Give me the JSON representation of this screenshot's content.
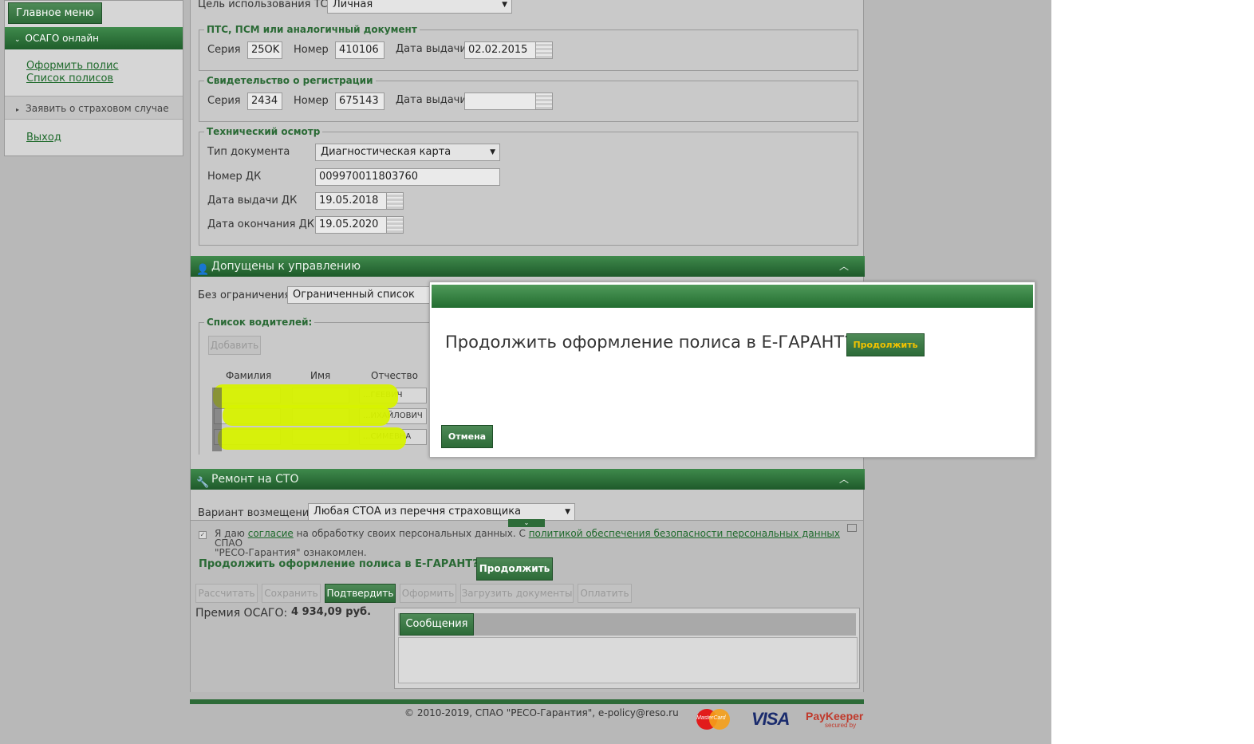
{
  "sidebar": {
    "main_menu": "Главное меню",
    "section_osago": "ОСАГО онлайн",
    "link_issue": "Оформить полис",
    "link_list": "Список полисов",
    "claim": "Заявить о страховом случае",
    "logout": "Выход"
  },
  "vehicle": {
    "purpose_label": "Цель использования ТС",
    "purpose_value": "Личная"
  },
  "pts": {
    "legend": "ПТС, ПСМ или аналогичный документ",
    "series_label": "Серия",
    "series_value": "25OK",
    "number_label": "Номер",
    "number_value": "410106",
    "date_label": "Дата выдачи",
    "date_value": "02.02.2015"
  },
  "registration": {
    "legend": "Свидетельство о регистрации",
    "series_label": "Серия",
    "series_value": "2434",
    "number_label": "Номер",
    "number_value": "675143",
    "date_label": "Дата выдачи",
    "date_value": ""
  },
  "inspection": {
    "legend": "Технический осмотр",
    "doc_type_label": "Тип документа",
    "doc_type_value": "Диагностическая карта",
    "dk_number_label": "Номер ДК",
    "dk_number_value": "009970011803760",
    "dk_issue_label": "Дата выдачи ДК",
    "dk_issue_value": "19.05.2018",
    "dk_end_label": "Дата окончания ДК",
    "dk_end_value": "19.05.2020"
  },
  "drivers_panel": {
    "title": "Допущены к управлению",
    "limit_label": "Без ограничения",
    "limit_value": "Ограниченный список",
    "list_legend": "Список водителей:",
    "add_button": "Добавить",
    "col_last": "Фамилия",
    "col_first": "Имя",
    "col_middle": "Отчество",
    "rows": [
      {
        "middle": "...ГЕЕВИЧ"
      },
      {
        "middle": "...ИХАЙЛОВИЧ"
      },
      {
        "middle": "...СИМЕВНА"
      }
    ]
  },
  "repair_panel": {
    "title": "Ремонт на СТО",
    "variant_label": "Вариант возмещения",
    "variant_value": "Любая СТОА из перечня страховщика"
  },
  "consent": {
    "text_1": "Я даю",
    "link_1": "согласие",
    "text_2": "на обработку своих персональных данных. С",
    "link_2": "политикой обеспечения безопасности персональных данных",
    "text_3": "СПАО",
    "text_4": "\"РЕСО-Гарантия\" ознакомлен."
  },
  "egarant": {
    "question": "Продолжить оформление полиса в Е-ГАРАНТ?",
    "continue_button": "Продолжить"
  },
  "actions": {
    "calculate": "Рассчитать",
    "save": "Сохранить",
    "confirm": "Подтвердить",
    "issue": "Оформить",
    "upload": "Загрузить документы",
    "pay": "Оплатить"
  },
  "premium": {
    "label": "Премия ОСАГО:",
    "value": "4 934,09 руб."
  },
  "messages": {
    "tab": "Сообщения"
  },
  "modal": {
    "question": "Продолжить оформление полиса в Е-ГАРАНТ?",
    "continue_button": "Продолжить",
    "cancel_button": "Отмена"
  },
  "footer": {
    "copyright": "© 2010-2019, СПАО \"РЕСО-Гарантия\", e-policy@reso.ru",
    "mastercard": "MasterCard",
    "visa": "VISA",
    "paykeeper": "PayKeeper",
    "paykeeper_sub": "secured by"
  },
  "colors": {
    "accent_green": "#2d6b38",
    "button_yellow_text": "#f2c200",
    "highlight_blur": "#d7f200"
  }
}
